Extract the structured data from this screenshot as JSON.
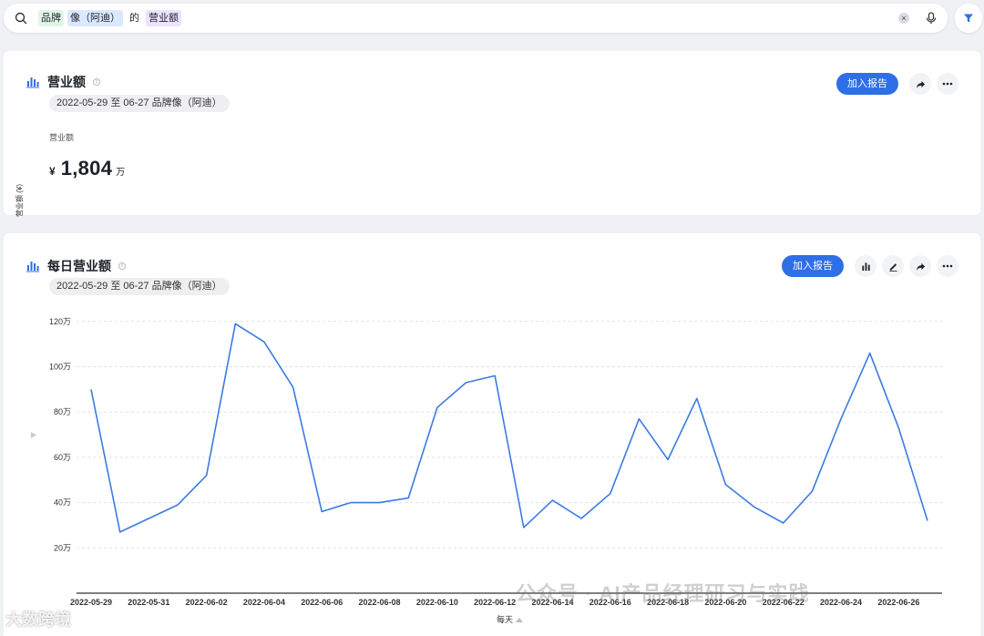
{
  "search": {
    "chips": [
      {
        "text": "品牌",
        "style": "green"
      },
      {
        "text": "像（阿迪）",
        "style": "blue"
      },
      {
        "text": "的",
        "style": "plain"
      },
      {
        "text": "营业额",
        "style": "purple"
      }
    ],
    "clear_label": "×"
  },
  "card1": {
    "title": "营业额",
    "info": "i",
    "filter_pill": "2022-05-29 至 06-27 品牌像（阿迪）",
    "add_report": "加入报告",
    "metric_label": "营业额",
    "metric_currency": "¥",
    "metric_value": "1,804",
    "metric_unit": "万"
  },
  "card2": {
    "title": "每日营业额",
    "info": "i",
    "filter_pill": "2022-05-29 至 06-27 品牌像（阿迪）",
    "add_report": "加入报告"
  },
  "colors": {
    "accent": "#2e6ee6",
    "line": "#3b7be3"
  },
  "chart_data": {
    "type": "line",
    "ylabel": "营业额 (¥)",
    "xlabel": "每天",
    "y_ticks": [
      "20万",
      "40万",
      "60万",
      "80万",
      "100万",
      "120万"
    ],
    "y_tick_values": [
      20,
      40,
      60,
      80,
      100,
      120
    ],
    "ylim": [
      0,
      120
    ],
    "x_tick_labels": [
      "2022-05-29",
      "2022-05-31",
      "2022-06-02",
      "2022-06-04",
      "2022-06-06",
      "2022-06-08",
      "2022-06-10",
      "2022-06-12",
      "2022-06-14",
      "2022-06-16",
      "2022-06-18",
      "2022-06-20",
      "2022-06-22",
      "2022-06-24",
      "2022-06-26"
    ],
    "x": [
      "2022-05-29",
      "2022-05-30",
      "2022-05-31",
      "2022-06-01",
      "2022-06-02",
      "2022-06-03",
      "2022-06-04",
      "2022-06-05",
      "2022-06-06",
      "2022-06-07",
      "2022-06-08",
      "2022-06-09",
      "2022-06-10",
      "2022-06-11",
      "2022-06-12",
      "2022-06-13",
      "2022-06-14",
      "2022-06-15",
      "2022-06-16",
      "2022-06-17",
      "2022-06-18",
      "2022-06-19",
      "2022-06-20",
      "2022-06-21",
      "2022-06-22",
      "2022-06-23",
      "2022-06-24",
      "2022-06-25",
      "2022-06-26",
      "2022-06-27"
    ],
    "values": [
      90,
      27,
      33,
      39,
      52,
      119,
      111,
      91,
      36,
      40,
      40,
      42,
      82,
      93,
      96,
      29,
      41,
      33,
      44,
      77,
      59,
      86,
      48,
      38,
      31,
      45,
      77,
      106,
      73,
      32
    ]
  },
  "watermark": {
    "text": "公众号 · AI产品经理研习与实践",
    "brand": "大数跨境"
  }
}
